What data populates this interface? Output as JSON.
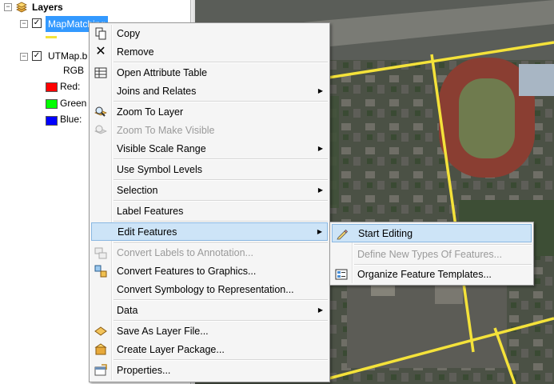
{
  "toc": {
    "root_label": "Layers",
    "layer1_name": "MapMatching",
    "layer2_name": "UTMap.b",
    "layer2_render": "RGB",
    "bands": [
      {
        "label": "Red:",
        "color": "#ff0000"
      },
      {
        "label": "Green",
        "color": "#00ff00"
      },
      {
        "label": "Blue:",
        "color": "#0000ff"
      }
    ]
  },
  "context_menu": {
    "items": [
      {
        "label": "Copy",
        "icon": "copy-icon"
      },
      {
        "label": "Remove",
        "icon": "remove-icon"
      },
      {
        "label": "Open Attribute Table",
        "icon": "table-icon"
      },
      {
        "label": "Joins and Relates",
        "submenu": true
      },
      {
        "label": "Zoom To Layer",
        "icon": "zoom-layer-icon"
      },
      {
        "label": "Zoom To Make Visible",
        "icon": "zoom-visible-icon",
        "disabled": true
      },
      {
        "label": "Visible Scale Range",
        "submenu": true
      },
      {
        "label": "Use Symbol Levels"
      },
      {
        "label": "Selection",
        "submenu": true
      },
      {
        "label": "Label Features"
      },
      {
        "label": "Edit Features",
        "submenu": true,
        "highlighted": true
      },
      {
        "label": "Convert Labels to Annotation...",
        "icon": "convert-labels-icon",
        "disabled": true
      },
      {
        "label": "Convert Features to Graphics...",
        "icon": "convert-graphics-icon"
      },
      {
        "label": "Convert Symbology to Representation..."
      },
      {
        "label": "Data",
        "submenu": true
      },
      {
        "label": "Save As Layer File...",
        "icon": "layer-file-icon"
      },
      {
        "label": "Create Layer Package...",
        "icon": "layer-package-icon"
      },
      {
        "label": "Properties...",
        "icon": "properties-icon"
      }
    ]
  },
  "edit_submenu": {
    "items": [
      {
        "label": "Start Editing",
        "icon": "pencil-icon",
        "highlighted": true
      },
      {
        "label": "Define New Types Of Features...",
        "disabled": true
      },
      {
        "label": "Organize Feature Templates...",
        "icon": "templates-icon"
      }
    ]
  },
  "colors": {
    "selection": "#3399ff",
    "menu_highlight": "#cde4f7",
    "road_lines": "#f4e23a"
  }
}
